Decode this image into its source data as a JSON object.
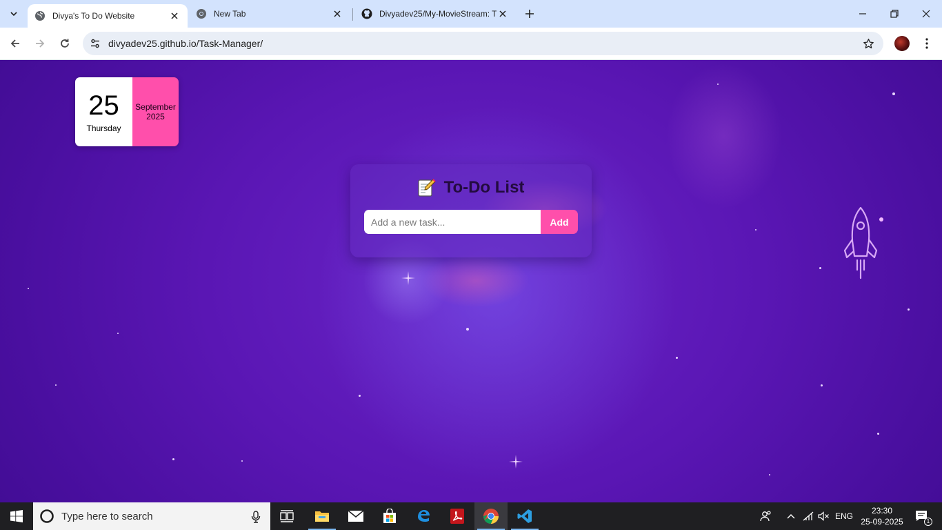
{
  "browser": {
    "tabs": [
      {
        "title": "Divya's To Do Website",
        "active": true,
        "icon": "globe-icon"
      },
      {
        "title": "New Tab",
        "active": false,
        "icon": "chrome-icon"
      },
      {
        "title": "Divyadev25/My-MovieStream: T",
        "active": false,
        "icon": "github-icon"
      }
    ],
    "url": "divyadev25.github.io/Task-Manager/"
  },
  "date_card": {
    "day": "25",
    "weekday": "Thursday",
    "month": "September",
    "year": "2025"
  },
  "todo": {
    "title": "To-Do List",
    "input_placeholder": "Add a new task...",
    "input_value": "",
    "add_label": "Add"
  },
  "taskbar": {
    "search_placeholder": "Type here to search",
    "apps": [
      "task-view-icon",
      "file-explorer-icon",
      "mail-icon",
      "store-icon",
      "edge-icon",
      "acrobat-icon",
      "chrome-icon",
      "vscode-icon"
    ],
    "language": "ENG",
    "time": "23:30",
    "date": "25-09-2025",
    "notification_count": "1"
  },
  "colors": {
    "accent_pink": "#ff4fab",
    "page_bg": "#5a14b0",
    "tabstrip": "#d3e3fd"
  }
}
